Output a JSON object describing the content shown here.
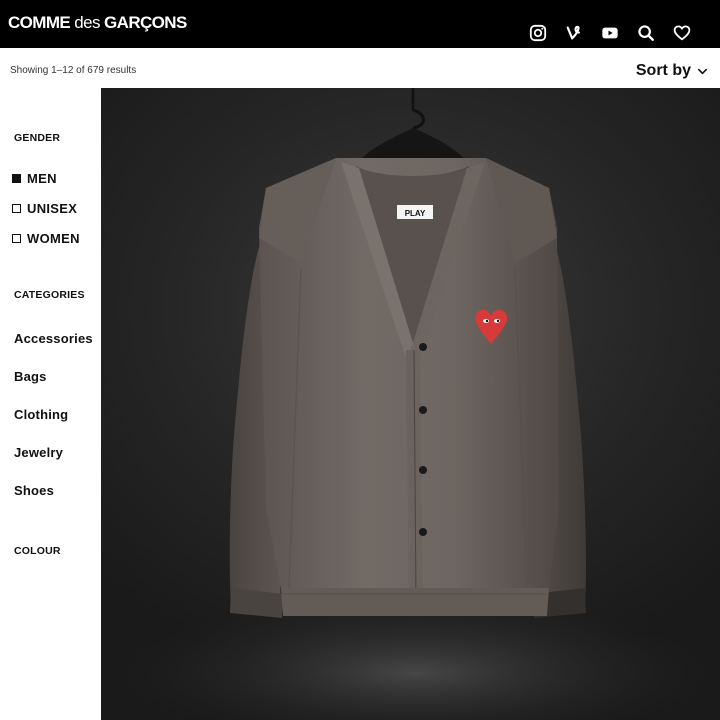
{
  "header": {
    "logo": {
      "main": "COMME",
      "des": " des ",
      "tail": "GARÇONS"
    },
    "icons": [
      "instagram-icon",
      "vine-icon",
      "youtube-icon",
      "search-icon",
      "heart-icon"
    ]
  },
  "results": {
    "count_text": "Showing 1–12 of 679 results",
    "sort_label": "Sort by"
  },
  "sidebar": {
    "gender_title": "GENDER",
    "gender_options": [
      {
        "label": "MEN",
        "checked": true
      },
      {
        "label": "UNISEX",
        "checked": false
      },
      {
        "label": "WOMEN",
        "checked": false
      }
    ],
    "categories_title": "CATEGORIES",
    "categories": [
      "Accessories",
      "Bags",
      "Clothing",
      "Jewelry",
      "Shoes"
    ],
    "colour_title": "COLOUR"
  },
  "product": {
    "label_text": "PLAY",
    "colors": {
      "background": "#262626",
      "cardigan": "#6e6661",
      "heart": "#d63a3a"
    }
  }
}
